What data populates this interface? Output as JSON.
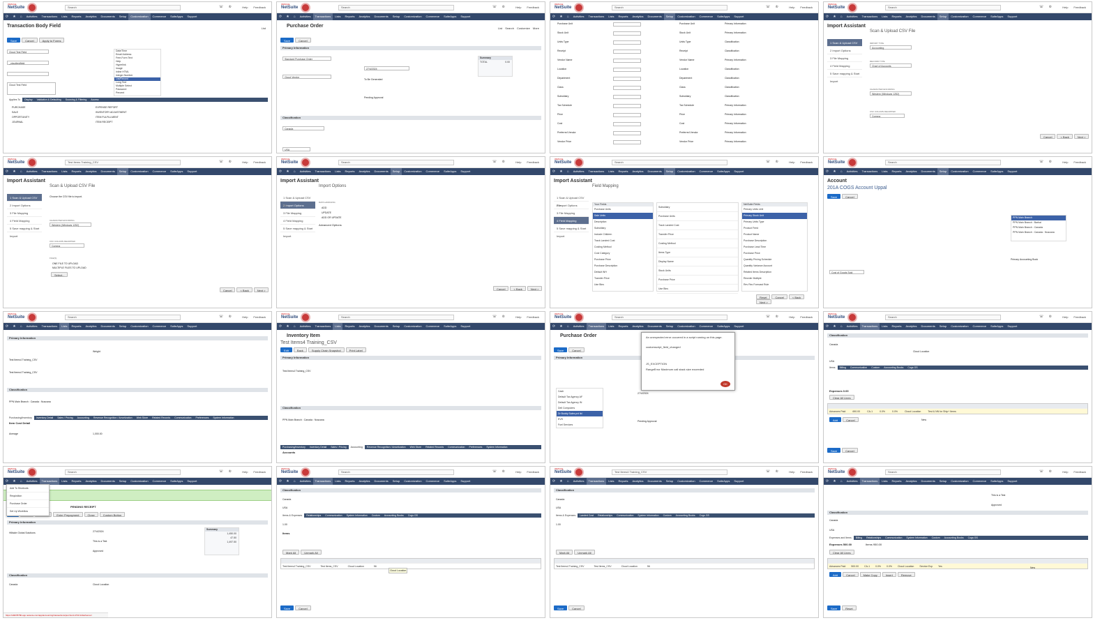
{
  "header": {
    "logo_top": "ORACLE",
    "logo_main": "NetSuite",
    "links": [
      "Help",
      "Feedback"
    ],
    "search_values": [
      "Search",
      "Search",
      "Search",
      "Search",
      "Test Items Training_CSV",
      "Search",
      "Search",
      "Search",
      "Search",
      "Search",
      "Search",
      "Search",
      "Search",
      "Search",
      "Test Items4 Training_CSV",
      "Search"
    ]
  },
  "nav_items": [
    "Activities",
    "Transactions",
    "Lists",
    "Reports",
    "Analytics",
    "Documents",
    "Setup",
    "Customization",
    "Commerce",
    "SuiteApps",
    "Support"
  ],
  "common": {
    "save": "Save",
    "cancel": "Cancel",
    "back": "< Back",
    "next": "Next >",
    "reset": "Reset",
    "actions": "Actions",
    "list": "List",
    "search": "Search",
    "customize": "Customize",
    "more": "More",
    "primary_information": "Primary Information",
    "classification": "Classification"
  },
  "tiles": {
    "t1": {
      "title": "Transaction Body Field",
      "apply": "Apply to Forms",
      "label_field": "Cloud Test Field",
      "id_field": "_cloudtestfield",
      "description": "Cloud Test Field",
      "type_options": [
        "Date/Time",
        "Email Address",
        "Free-Form Text",
        "Help",
        "Hyperlink",
        "Image",
        "Inline HTML",
        "Integer Number",
        "List/Record",
        "Long Text",
        "Multiple Select",
        "Password",
        "Percent"
      ],
      "tabs": [
        "Applies To",
        "Display",
        "Validation & Defaulting",
        "Sourcing & Filtering",
        "Access"
      ],
      "checks": [
        "PURCHASE",
        "SALE",
        "OPPORTUNITY",
        "JOURNAL",
        "EXPENSE REPORT",
        "INVENTORY ADJUSTMENT",
        "ITEM FULFILLMENT",
        "ITEM RECEIPT"
      ]
    },
    "t2": {
      "title": "Purchase Order",
      "form": "Standard Purchase Order",
      "vendor": "Cloud Vendor",
      "date": "27/4/2024",
      "memo": "To Be Generated",
      "approval": "Pending Approval",
      "subsidiary": "Canada",
      "currency": "USA",
      "summary_title": "Summary",
      "summary_total_label": "TOTAL",
      "summary_total": "0.00"
    },
    "t3": {
      "rows": [
        "Purchase Unit",
        "Stock Unit",
        "Units Type",
        "Receipt",
        "Vendor Name",
        "Location",
        "Department",
        "Class",
        "Subsidiary",
        "Tax Schedule",
        "Price",
        "Cost",
        "Preferred Vendor",
        "Vendor Price"
      ],
      "mapped": [
        "Primary Information",
        "Primary Information",
        "Classification",
        "Classification",
        "Primary Information",
        "Classification",
        "Classification",
        "Classification",
        "Classification",
        "Primary Information",
        "Primary Information",
        "Primary Information",
        "Primary Information",
        "Primary Information"
      ]
    },
    "t4": {
      "title": "Import Assistant",
      "step_title": "Scan & Upload CSV File",
      "steps": [
        "1 Scan & Upload CSV File",
        "2 Import Options",
        "3 File Mapping",
        "4 Field Mapping",
        "5 Save mapping & Start Import"
      ],
      "import_type_label": "IMPORT TYPE",
      "import_type": "Accounting",
      "record_type_label": "RECORD TYPE",
      "record_type": "Chart of Accounts",
      "encoding_label": "CHARACTER ENCODING",
      "encoding": "Western (Windows 1252)",
      "delimiter_label": "CSV COLUMN DELIMITER",
      "delimiter": "Comma"
    },
    "t5": {
      "title": "Import Assistant",
      "step_title": "Scan & Upload CSV File",
      "file_note": "Choose the CSV file to import.",
      "encoding": "Western (Windows 1252)",
      "delimiter": "Comma",
      "files_label": "FILE(S)",
      "one_file": "ONE FILE TO UPLOAD",
      "multi_file": "MULTIPLE FILES TO UPLOAD",
      "select": "Select..."
    },
    "t6": {
      "title": "Import Assistant",
      "step_title": "Import Options",
      "handling_label": "DATA HANDLING",
      "options": [
        "ADD",
        "UPDATE",
        "ADD OR UPDATE"
      ],
      "advanced": "Advanced Options"
    },
    "t7": {
      "title": "Import Assistant",
      "step_title": "Field Mapping",
      "left_header": "Your Fields",
      "left_items": [
        "Purchase Units",
        "Sale Units",
        "Description",
        "Subsidiary",
        "Include Children",
        "Track Landed Cost",
        "Costing Method",
        "Cost Category",
        "Purchase Price",
        "Purchase Description",
        "Default WH",
        "Transfer Price",
        "Use Bins"
      ],
      "mid_items": [
        "Subsidiary",
        "Purchase Units",
        "Track Landed Cost",
        "Transfer Price",
        "Costing Method",
        "Items Type",
        "Display Name",
        "Stock Units",
        "Purchase Price",
        "Use Bins"
      ],
      "right_header": "NetSuite Fields",
      "right_items": [
        "Primary Units Unit",
        "Primary Stock Unit",
        "Primary Units Type",
        "Product Feed",
        "Product Name",
        "Purchase Description",
        "Purchase Lead Time",
        "Purchase Price",
        "Quantity Pricing Schedule",
        "Quantity Variance Account",
        "Related Items Description",
        "Reorder Multiple",
        "Rev Rec Forecast Rule"
      ]
    },
    "t8": {
      "title": "Account",
      "subtitle": "201A COGS Account Uppal",
      "type": "Cost of Goods Sold",
      "subsidiaries": [
        "PPN Main Branch",
        "PPN Main Branch : Barhai",
        "PPN Main Branch : Canada",
        "PPN Main Branch : Canada : Nuscana"
      ],
      "desc": "Primary Accounting Book"
    },
    "t9": {
      "tabs": [
        "Purchasing/Inventory",
        "Inventory Detail",
        "Sales / Pricing",
        "Accounting",
        "Revenue Recognition / Amortization",
        "Web Store",
        "Related Records",
        "Communication",
        "Preferences",
        "System Information"
      ],
      "item_name": "Test Items4 Training_CSV",
      "upc": "Test Items4 Training_CSV",
      "subsidiary": "PPN Main Branch : Canada : Nuscana",
      "weight_unit": "Weight",
      "purchase_price": "1,000.00",
      "costing": "Average",
      "sub_section": "Item Cost Detail"
    },
    "t10": {
      "title": "Inventory Item",
      "subtitle": "Test Items4 Training_CSV",
      "buttons": [
        "Edit",
        "Back",
        "Supply Chain Snapshot",
        "Print Label"
      ],
      "subsidiary": "PPN Main Branch : Canada : Nuscana",
      "tabs": [
        "Purchasing/Inventory",
        "Inventory Detail",
        "Sales / Pricing",
        "Accounting",
        "Revenue Recognition / Amortization",
        "Web Store",
        "Related Records",
        "Communication",
        "Preferences",
        "System Information"
      ],
      "accounts": "Accounts"
    },
    "t11": {
      "title": "Purchase Order",
      "dialog_line1": "An unexpected error occurred in a script running on this page.",
      "dialog_line2": "customscript_field_changed",
      "dialog_line3": "JS_EXCEPTION",
      "dialog_line4": "RangeError Maximum call stack size exceeded",
      "ok": "OK",
      "dropdown": [
        "Cash",
        "Default Tax Agency AF",
        "Default Tax Agency IN",
        "Dell Computers",
        "Dr Buddy Sales pvt ltd",
        "EVS",
        "Fuel Services"
      ],
      "date": "27/4/2024",
      "approval": "Pending Approval"
    },
    "t12": {
      "subsidiary": "Canada",
      "location": "Cloud Location",
      "currency": "USA",
      "tabs": [
        "Items",
        "Billing",
        "Communication",
        "Custom",
        "Accounting Books",
        "Cogs GS"
      ],
      "expenses": "Expenses 0.00",
      "items_count": "Items 950.00",
      "clear": "Clear All Lines",
      "row": [
        "Advances Paid",
        "690.00",
        "CA-1",
        "0.0%",
        "0.0%"
      ],
      "row_location": "Cloud Location",
      "row_customer": "Test & NN for Ship+ Items",
      "add": "Add",
      "new": "New"
    },
    "t13": {
      "menu": [
        "Add To Shortcuts",
        "Requisition",
        "Purchase Order",
        "Set Up Workflow"
      ],
      "po_title": "12 ... Solutions",
      "pending": "PENDING RECEIPT",
      "buttons": [
        "Edit",
        "Back",
        "Receive",
        "Enter Prepayment",
        "Close",
        "Custom Button"
      ],
      "vendor": "Hillside Global Solutions",
      "date": "27/4/2024",
      "memo": "This is a Test",
      "approval": "Approved",
      "summary_title": "Summary",
      "subtotal": "1,450.00",
      "tax": "47.50",
      "total": "1,497.50",
      "subsidiary": "Canada",
      "location": "Cloud Location",
      "url": "https://td3078780.app.netsuite.com/app/accounting/transactions/purchord.nl?id=12&whence="
    },
    "t14": {
      "subsidiary": "Canada",
      "currency": "USA",
      "tabs": [
        "Items & Expenses",
        "Relationships",
        "Communication",
        "System Information",
        "Custom",
        "Accounting Books",
        "Cogs GS"
      ],
      "exchange": "1.00",
      "items_label": "Items",
      "expenses_label": "Expenses",
      "buttons": [
        "Mark All",
        "Unmark All"
      ],
      "row_item": "Test Items4 Training_CSV",
      "row_desc": "Test Items_CSV",
      "row_loc": "Cloud Location",
      "row_qty": "56",
      "tip": "Cloud Location"
    },
    "t15": {
      "subsidiary": "Canada",
      "currency": "USA",
      "tabs": [
        "Items & Expenses",
        "Landed Cost",
        "Relationships",
        "Communication",
        "System Information",
        "Custom",
        "Accounting Books",
        "Cogs GS"
      ],
      "exchange": "1.00",
      "buttons": [
        "Mark All",
        "Unmark All"
      ],
      "row_item": "Test Items4 Training_CSV",
      "row_desc": "Test Items_CSV",
      "row_loc": "Cloud Location",
      "row_qty": "56"
    },
    "t16": {
      "memo": "This is a Test",
      "approval": "Approved",
      "subsidiary": "Canada",
      "currency": "USA",
      "tabs": [
        "Expenses and Items",
        "Billing",
        "Relationships",
        "Communication",
        "System Information",
        "Custom",
        "Accounting Books",
        "Cogs GS"
      ],
      "expenses": "Expenses 500.00",
      "items": "Items 950.00",
      "clear": "Clear All Lines",
      "row": [
        "Advances Paid",
        "500.00",
        "CA-1",
        "0.0%",
        "0.0%"
      ],
      "row_loc": "Cloud Location",
      "row_class": "Service Exp",
      "row_yes": "Yes",
      "buttons": [
        "Add",
        "Cancel",
        "Make Copy",
        "Insert",
        "Remove"
      ],
      "new": "New"
    }
  }
}
